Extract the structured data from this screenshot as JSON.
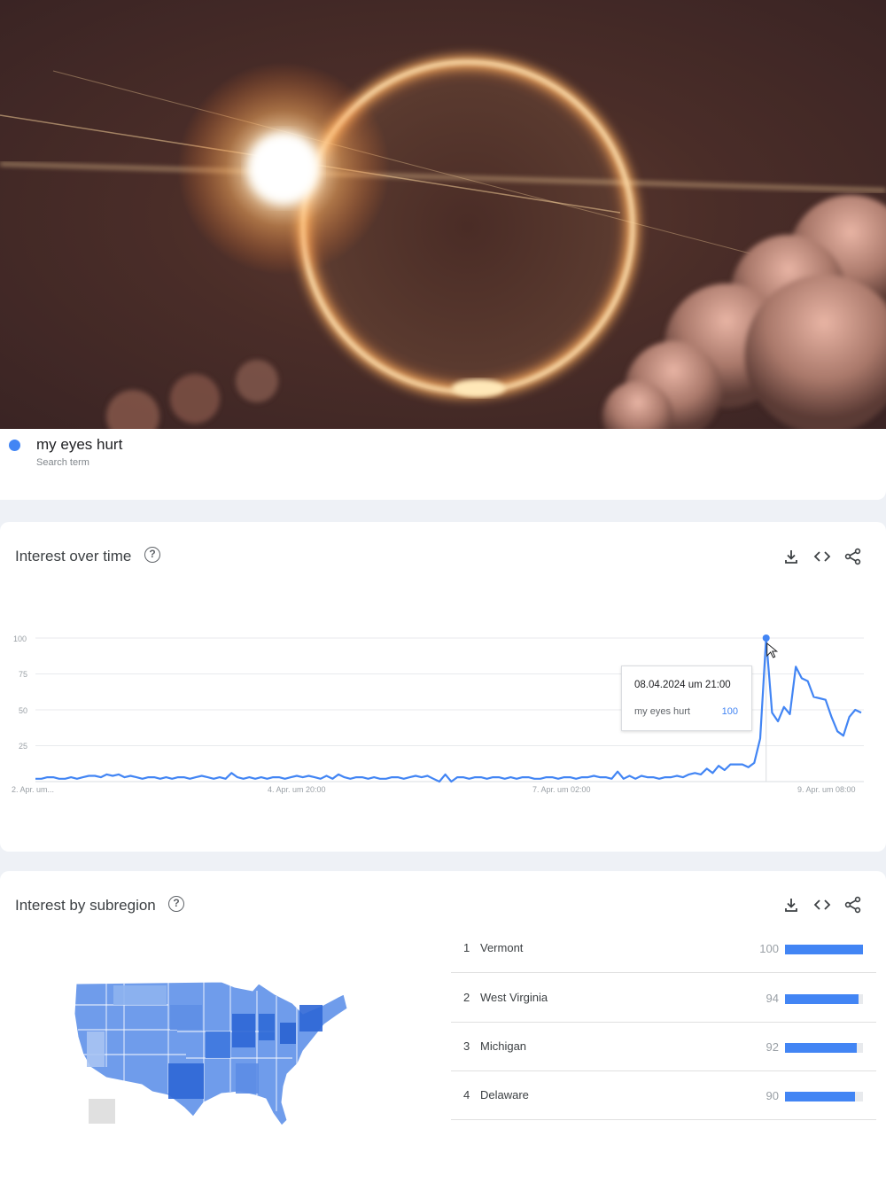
{
  "search_term": {
    "name": "my eyes hurt",
    "subtitle": "Search term",
    "color": "#4285f4"
  },
  "interest_over_time": {
    "title": "Interest over time",
    "help_icon": "help-circle-icon",
    "tools": [
      "download-icon",
      "embed-code-icon",
      "share-icon"
    ],
    "tooltip": {
      "date": "08.04.2024 um 21:00",
      "series_label": "my eyes hurt",
      "value": "100"
    }
  },
  "chart_data": {
    "type": "line",
    "y_ticks": [
      "100",
      "75",
      "50",
      "25"
    ],
    "x_ticks": [
      "2. Apr. um...",
      "4. Apr. um 20:00",
      "7. Apr. um 02:00",
      "9. Apr. um 08:00"
    ],
    "ylim": [
      0,
      100
    ],
    "grid": true,
    "series": [
      {
        "name": "my eyes hurt",
        "color": "#4285f4",
        "values": [
          2,
          2,
          3,
          3,
          2,
          2,
          3,
          2,
          3,
          4,
          4,
          3,
          5,
          4,
          5,
          3,
          4,
          3,
          2,
          3,
          3,
          2,
          3,
          2,
          3,
          3,
          2,
          3,
          4,
          3,
          2,
          3,
          2,
          6,
          3,
          2,
          3,
          2,
          3,
          2,
          3,
          3,
          2,
          3,
          4,
          3,
          4,
          3,
          2,
          4,
          2,
          5,
          3,
          2,
          3,
          3,
          2,
          3,
          2,
          2,
          3,
          3,
          2,
          3,
          4,
          3,
          4,
          2,
          0,
          5,
          0,
          3,
          3,
          2,
          3,
          3,
          2,
          3,
          3,
          2,
          3,
          2,
          3,
          3,
          2,
          2,
          3,
          3,
          2,
          3,
          3,
          2,
          3,
          3,
          4,
          3,
          3,
          2,
          7,
          2,
          4,
          2,
          4,
          3,
          3,
          2,
          3,
          3,
          4,
          3,
          5,
          6,
          5,
          9,
          6,
          11,
          8,
          12,
          12,
          12,
          10,
          13,
          30,
          100,
          48,
          42,
          52,
          47,
          80,
          72,
          70,
          59,
          58,
          57,
          45,
          35,
          32,
          45,
          50,
          48
        ]
      }
    ]
  },
  "interest_by_subregion": {
    "title": "Interest by subregion",
    "help_icon": "help-circle-icon",
    "tools": [
      "download-icon",
      "embed-code-icon",
      "share-icon"
    ],
    "regions": [
      {
        "rank": "1",
        "name": "Vermont",
        "value": "100",
        "level": 100
      },
      {
        "rank": "2",
        "name": "West Virginia",
        "value": "94",
        "level": 94
      },
      {
        "rank": "3",
        "name": "Michigan",
        "value": "92",
        "level": 92
      },
      {
        "rank": "4",
        "name": "Delaware",
        "value": "90",
        "level": 90
      }
    ]
  }
}
